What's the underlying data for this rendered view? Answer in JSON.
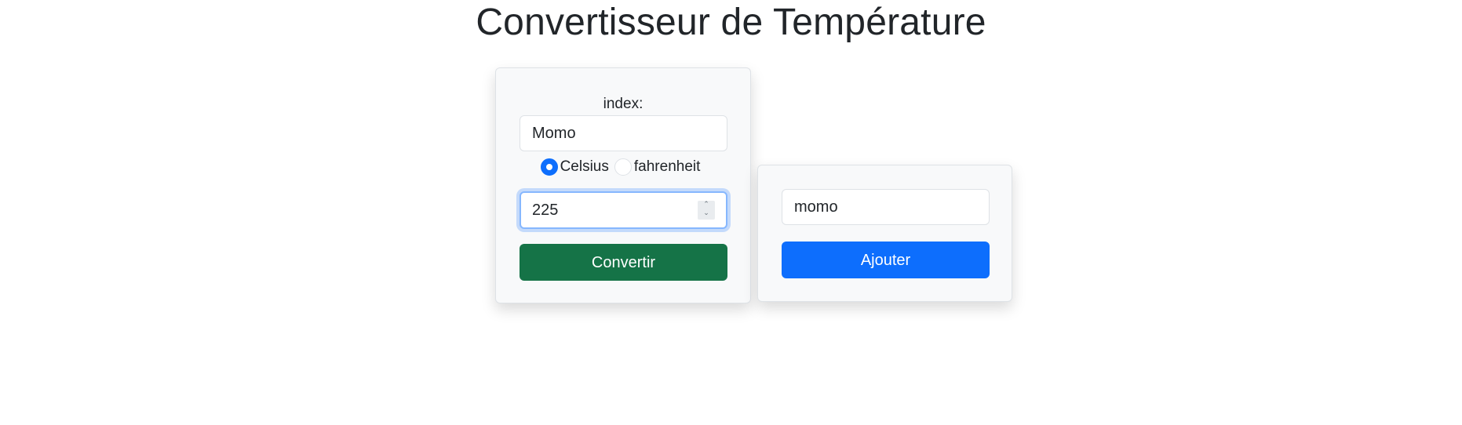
{
  "page": {
    "title": "Convertisseur de Température"
  },
  "converter": {
    "index_label": "index:",
    "index_value": "Momo",
    "units": [
      {
        "label": "Celsius",
        "checked": true
      },
      {
        "label": "fahrenheit",
        "checked": false
      }
    ],
    "temperature_value": "225",
    "convert_label": "Convertir"
  },
  "adder": {
    "name_value": "momo",
    "add_label": "Ajouter"
  },
  "colors": {
    "convert_button": "#157347",
    "add_button": "#0d6efd",
    "radio_checked": "#0d6efd",
    "focus_ring": "#86b7fe"
  },
  "icons": {
    "spinner_up": "chevron-up-icon",
    "spinner_down": "chevron-down-icon"
  }
}
